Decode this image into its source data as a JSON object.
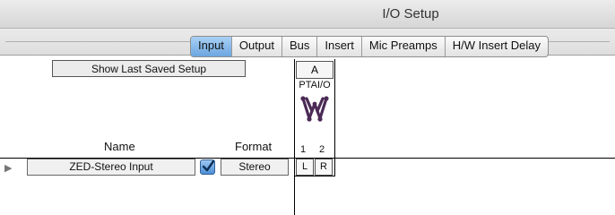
{
  "window": {
    "title": "I/O Setup"
  },
  "tabs": [
    {
      "label": "Input",
      "active": true
    },
    {
      "label": "Output",
      "active": false
    },
    {
      "label": "Bus",
      "active": false
    },
    {
      "label": "Insert",
      "active": false
    },
    {
      "label": "Mic Preamps",
      "active": false
    },
    {
      "label": "H/W Insert Delay",
      "active": false
    }
  ],
  "controls": {
    "show_last_saved": "Show Last Saved Setup"
  },
  "columns": {
    "name_header": "Name",
    "format_header": "Format",
    "device_group": "A",
    "device_name": "PTAI/O",
    "channel_numbers": [
      "1",
      "2"
    ]
  },
  "rows": [
    {
      "name": "ZED-Stereo Input",
      "enabled": true,
      "format": "Stereo",
      "channels": [
        "L",
        "R"
      ]
    }
  ],
  "colors": {
    "active_tab": "#6ca6e0",
    "device_icon": "#4b2a55"
  }
}
